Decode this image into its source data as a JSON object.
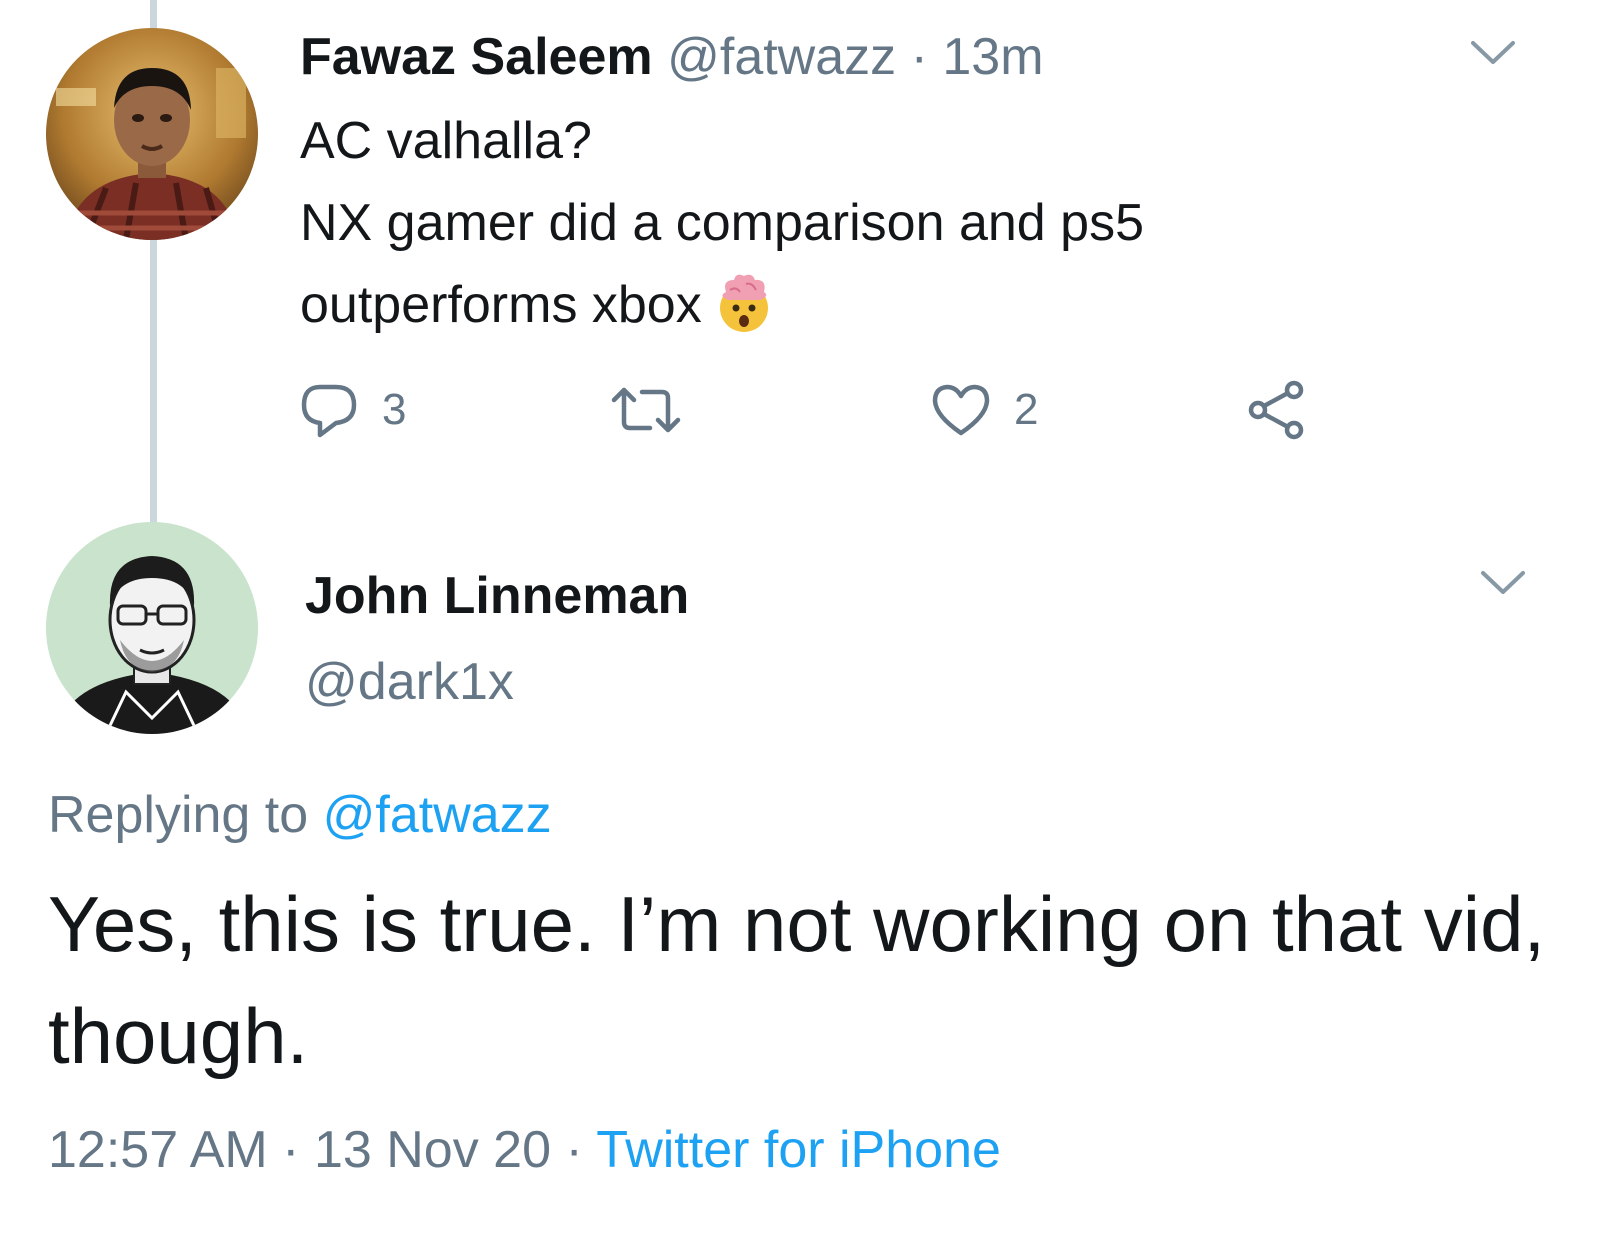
{
  "parent_tweet": {
    "display_name": "Fawaz Saleem",
    "handle": "@fatwazz",
    "separator": "·",
    "time_ago": "13m",
    "text_lines": [
      "AC valhalla?",
      "NX gamer did a comparison and ps5",
      "outperforms xbox"
    ],
    "emoji": "exploding-head-emoji",
    "reply_count": "3",
    "like_count": "2"
  },
  "reply_tweet": {
    "display_name": "John Linneman",
    "handle": "@dark1x",
    "replying_prefix": "Replying to",
    "replying_handle": "@fatwazz",
    "text": "Yes, this is true. I’m not working on that vid, though.",
    "time": "12:57 AM",
    "date": "13 Nov 20",
    "separator": "·",
    "source": "Twitter for iPhone"
  },
  "colors": {
    "text": "#14171a",
    "muted": "#657786",
    "link": "#1da1f2",
    "thread_line": "#ccd6dd"
  }
}
